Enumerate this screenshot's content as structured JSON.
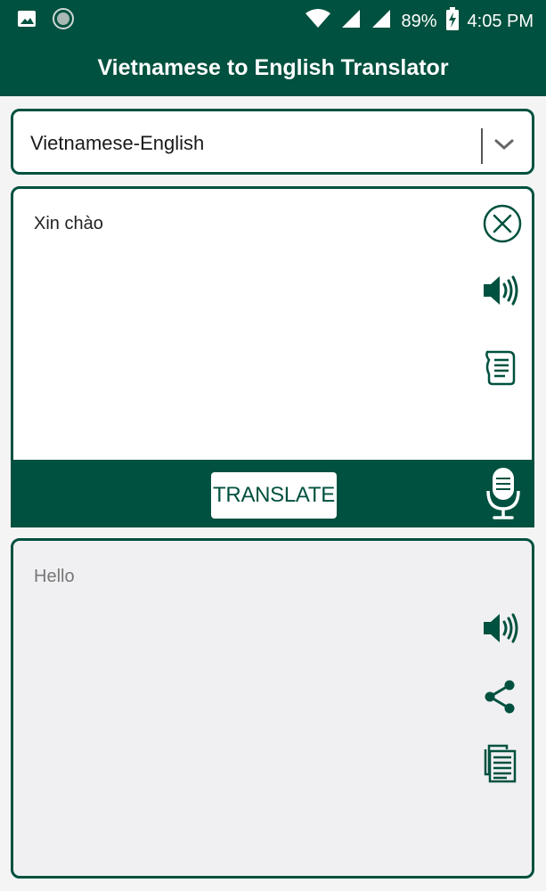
{
  "status_bar": {
    "battery": "89%",
    "time": "4:05 PM"
  },
  "app": {
    "title": "Vietnamese to English Translator"
  },
  "language_selector": {
    "selected": "Vietnamese-English"
  },
  "input": {
    "text": "Xin chào"
  },
  "actions": {
    "translate_label": "TRANSLATE"
  },
  "output": {
    "text": "Hello"
  },
  "colors": {
    "primary": "#00513f",
    "surface": "#ffffff",
    "output_surface": "#f0f0f2"
  },
  "icons": {
    "status_left": [
      "image-icon",
      "app-icon"
    ],
    "status_right": [
      "wifi-icon",
      "signal-icon",
      "signal-icon",
      "battery-charging-icon"
    ],
    "input_side": [
      "clear-icon",
      "speaker-icon",
      "dictionary-icon"
    ],
    "translate_bar": [
      "microphone-icon"
    ],
    "output_side": [
      "speaker-icon",
      "share-icon",
      "copy-icon"
    ]
  }
}
